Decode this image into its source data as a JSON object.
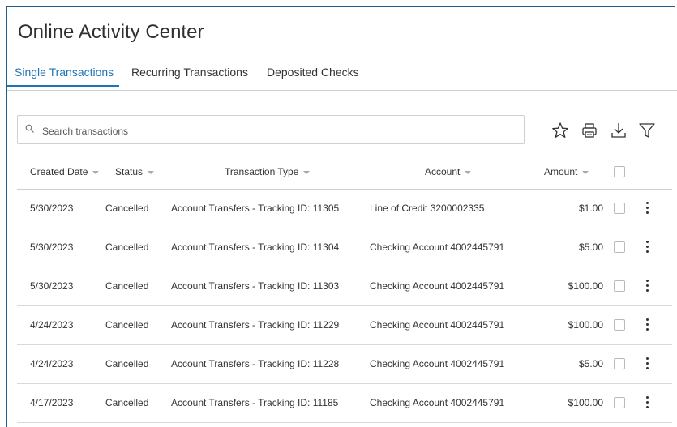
{
  "page_title": "Online Activity Center",
  "tabs": [
    {
      "label": "Single Transactions",
      "active": true
    },
    {
      "label": "Recurring Transactions",
      "active": false
    },
    {
      "label": "Deposited Checks",
      "active": false
    }
  ],
  "search": {
    "placeholder": "Search transactions",
    "value": ""
  },
  "toolbar": {
    "icons": [
      "star-icon",
      "print-icon",
      "download-icon",
      "filter-icon"
    ]
  },
  "table": {
    "columns": [
      "Created Date",
      "Status",
      "Transaction Type",
      "Account",
      "Amount"
    ],
    "rows": [
      {
        "date": "5/30/2023",
        "status": "Cancelled",
        "type": "Account Transfers - Tracking ID: 11305",
        "account": "Line of Credit 3200002335",
        "amount": "$1.00"
      },
      {
        "date": "5/30/2023",
        "status": "Cancelled",
        "type": "Account Transfers - Tracking ID: 11304",
        "account": "Checking Account 4002445791",
        "amount": "$5.00"
      },
      {
        "date": "5/30/2023",
        "status": "Cancelled",
        "type": "Account Transfers - Tracking ID: 11303",
        "account": "Checking Account 4002445791",
        "amount": "$100.00"
      },
      {
        "date": "4/24/2023",
        "status": "Cancelled",
        "type": "Account Transfers - Tracking ID: 11229",
        "account": "Checking Account 4002445791",
        "amount": "$100.00"
      },
      {
        "date": "4/24/2023",
        "status": "Cancelled",
        "type": "Account Transfers - Tracking ID: 11228",
        "account": "Checking Account 4002445791",
        "amount": "$5.00"
      },
      {
        "date": "4/17/2023",
        "status": "Cancelled",
        "type": "Account Transfers - Tracking ID: 11185",
        "account": "Checking Account 4002445791",
        "amount": "$100.00"
      }
    ]
  },
  "colors": {
    "accent": "#1f74b4",
    "frame_border": "#1f5f8f"
  }
}
